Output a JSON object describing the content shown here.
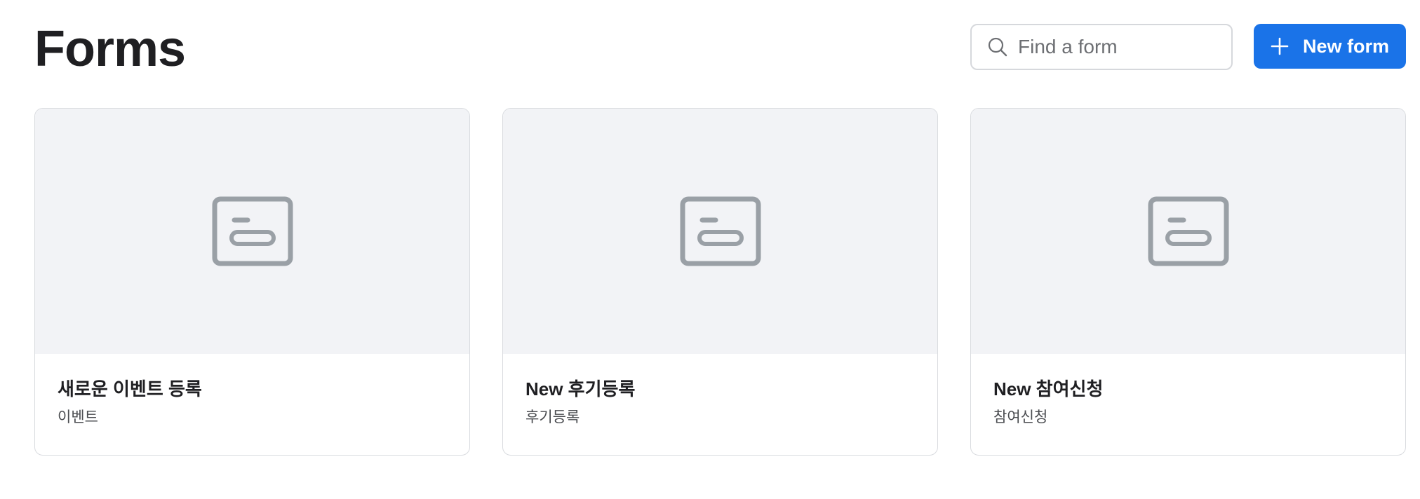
{
  "header": {
    "title": "Forms",
    "search_placeholder": "Find a form",
    "new_button_label": "New form"
  },
  "colors": {
    "accent": "#1a73e8",
    "thumbnail_bg": "#f2f3f6",
    "icon_gray": "#9aa0a6"
  },
  "icons": {
    "search": "search-icon",
    "new": "plus-icon",
    "form": "form-icon"
  },
  "forms": [
    {
      "title": "새로운 이벤트 등록",
      "subtitle": "이벤트"
    },
    {
      "title": "New 후기등록",
      "subtitle": "후기등록"
    },
    {
      "title": "New 참여신청",
      "subtitle": "참여신청"
    }
  ]
}
